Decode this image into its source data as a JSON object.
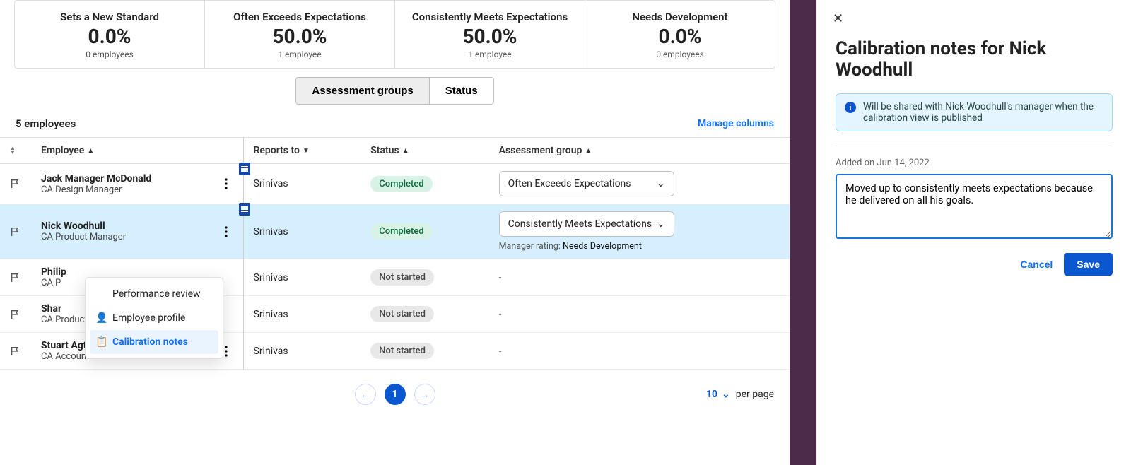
{
  "summary_cards": [
    {
      "title": "Sets a New Standard",
      "percent": "0.0%",
      "sub": "0 employees"
    },
    {
      "title": "Often Exceeds Expectations",
      "percent": "50.0%",
      "sub": "1 employee"
    },
    {
      "title": "Consistently Meets Expectations",
      "percent": "50.0%",
      "sub": "1 employee"
    },
    {
      "title": "Needs Development",
      "percent": "0.0%",
      "sub": "0 employees"
    }
  ],
  "segment": {
    "groups": "Assessment groups",
    "status": "Status",
    "active": "groups"
  },
  "meta": {
    "count": "5 employees",
    "manage": "Manage columns"
  },
  "columns": {
    "employee": "Employee",
    "reports": "Reports to",
    "status": "Status",
    "assessment": "Assessment group"
  },
  "rows": [
    {
      "name": "Jack Manager McDonald",
      "role": "CA Design Manager",
      "reports": "Srinivas",
      "status": "Completed",
      "status_style": "green",
      "assessment": "Often Exceeds Expectations",
      "has_note": true
    },
    {
      "name": "Nick Woodhull",
      "role": "CA Product Manager",
      "reports": "Srinivas",
      "status": "Completed",
      "status_style": "green",
      "assessment": "Consistently Meets Expectations",
      "has_note": true,
      "manager_rating_label": "Manager rating:",
      "manager_rating_value": "Needs Development",
      "selected": true
    },
    {
      "name": "Philip",
      "role": "CA P",
      "reports": "Srinivas",
      "status": "Not started",
      "status_style": "grey",
      "assessment": "-"
    },
    {
      "name": "Shar",
      "role": "CA Product Person",
      "reports": "Srinivas",
      "status": "Not started",
      "status_style": "grey",
      "assessment": "-"
    },
    {
      "name": "Stuart Agtsteribbe",
      "role": "CA Account Executive",
      "reports": "Srinivas",
      "status": "Not started",
      "status_style": "grey",
      "assessment": "-"
    }
  ],
  "menu": {
    "perf": "Performance review",
    "profile": "Employee profile",
    "notes": "Calibration notes"
  },
  "pager": {
    "current": "1",
    "page_size": "10",
    "per_page": "per page"
  },
  "panel": {
    "title": "Calibration notes for Nick Woodhull",
    "banner": "Will be shared with Nick Woodhull's manager when the calibration view is published",
    "added": "Added on Jun 14, 2022",
    "note": "Moved up to consistently meets expectations because he delivered on all his goals.",
    "cancel": "Cancel",
    "save": "Save"
  }
}
